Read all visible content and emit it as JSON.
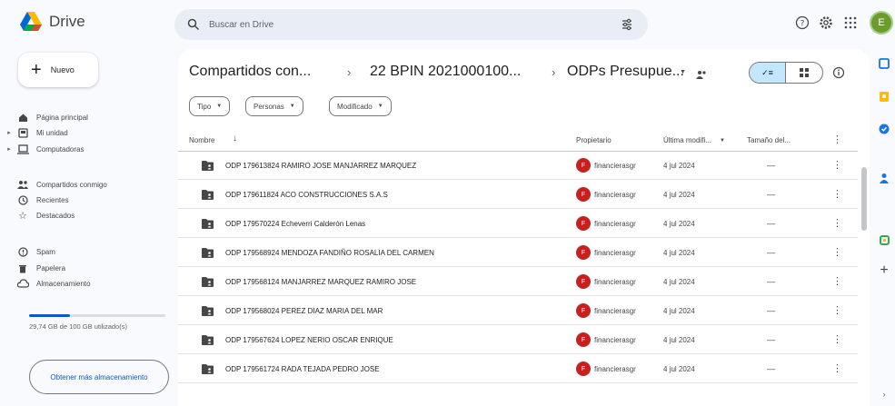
{
  "app": {
    "name": "Drive"
  },
  "search": {
    "placeholder": "Buscar en Drive"
  },
  "sidebar": {
    "new_label": "Nuevo",
    "items": [
      {
        "label": "Página principal",
        "icon": "home-icon"
      },
      {
        "label": "Mi unidad",
        "icon": "drive-icon"
      },
      {
        "label": "Computadoras",
        "icon": "computer-icon"
      },
      {
        "label": "Compartidos conmigo",
        "icon": "people-icon"
      },
      {
        "label": "Recientes",
        "icon": "clock-icon"
      },
      {
        "label": "Destacados",
        "icon": "star-icon"
      },
      {
        "label": "Spam",
        "icon": "spam-icon"
      },
      {
        "label": "Papelera",
        "icon": "trash-icon"
      },
      {
        "label": "Almacenamiento",
        "icon": "cloud-icon"
      }
    ],
    "storage": {
      "text": "29,74 GB de 100 GB utilizado(s)",
      "fraction": 0.2974,
      "button": "Obtener más almacenamiento"
    }
  },
  "breadcrumb": [
    "Compartidos con...",
    "22 BPIN 2021000100...",
    "ODPs Presupue..."
  ],
  "view_toggle": {
    "list_label": "✓≡"
  },
  "filters": [
    "Tipo",
    "Personas",
    "Modificado"
  ],
  "table": {
    "headers": {
      "name": "Nombre",
      "owner": "Propietario",
      "modified": "Última modifi...",
      "size": "Tamaño del..."
    },
    "rows": [
      {
        "name": "ODP 179613824 RAMIRO JOSE MANJARREZ MARQUEZ",
        "owner": "financierasgr",
        "avatar": "F",
        "date": "4 jul 2024",
        "size": "—"
      },
      {
        "name": "ODP 179611824 ACO CONSTRUCCIONES S.A.S",
        "owner": "financierasgr",
        "avatar": "F",
        "date": "4 jul 2024",
        "size": "—"
      },
      {
        "name": "ODP 179570224 Echeverri Calderón Lenas",
        "owner": "financierasgr",
        "avatar": "F",
        "date": "4 jul 2024",
        "size": "—"
      },
      {
        "name": "ODP 179568924 MENDOZA FANDIÑO ROSALIA DEL CARMEN",
        "owner": "financierasgr",
        "avatar": "F",
        "date": "4 jul 2024",
        "size": "—"
      },
      {
        "name": "ODP 179568124 MANJARREZ MARQUEZ RAMIRO JOSE",
        "owner": "financierasgr",
        "avatar": "F",
        "date": "4 jul 2024",
        "size": "—"
      },
      {
        "name": "ODP 179568024 PEREZ DIAZ MARIA DEL MAR",
        "owner": "financierasgr",
        "avatar": "F",
        "date": "4 jul 2024",
        "size": "—"
      },
      {
        "name": "ODP 179567624 LOPEZ NERIO OSCAR ENRIQUE",
        "owner": "financierasgr",
        "avatar": "F",
        "date": "4 jul 2024",
        "size": "—"
      },
      {
        "name": "ODP 179561724 RADA TEJADA PEDRO JOSE",
        "owner": "financierasgr",
        "avatar": "F",
        "date": "4 jul 2024",
        "size": "—"
      }
    ]
  },
  "colors": {
    "accent": "#0b57d0",
    "owner_avatar": "#c5221f",
    "toggle_active": "#c2e7ff"
  }
}
